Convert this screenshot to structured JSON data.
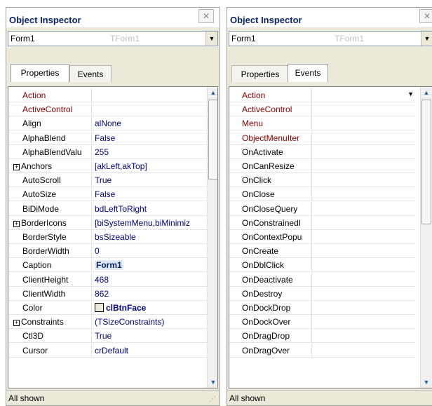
{
  "panels": [
    {
      "title": "Object Inspector",
      "combo": {
        "name": "Form1",
        "type": "TForm1"
      },
      "tabs": [
        "Properties",
        "Events"
      ],
      "active_tab": "Properties",
      "rows": [
        {
          "name": "Action",
          "value": "",
          "red": true
        },
        {
          "name": "ActiveControl",
          "value": "",
          "red": true
        },
        {
          "name": "Align",
          "value": "alNone"
        },
        {
          "name": "AlphaBlend",
          "value": "False"
        },
        {
          "name": "AlphaBlendValu",
          "value": "255"
        },
        {
          "name": "Anchors",
          "value": "[akLeft,akTop]",
          "expand": "⊞"
        },
        {
          "name": "AutoScroll",
          "value": "True"
        },
        {
          "name": "AutoSize",
          "value": "False"
        },
        {
          "name": "BiDiMode",
          "value": "bdLeftToRight"
        },
        {
          "name": "BorderIcons",
          "value": "[biSystemMenu,biMinimiz",
          "expand": "⊞"
        },
        {
          "name": "BorderStyle",
          "value": "bsSizeable"
        },
        {
          "name": "BorderWidth",
          "value": "0"
        },
        {
          "name": "Caption",
          "value": "Form1",
          "selected": true
        },
        {
          "name": "ClientHeight",
          "value": "468"
        },
        {
          "name": "ClientWidth",
          "value": "862"
        },
        {
          "name": "Color",
          "value": "clBtnFace",
          "swatch": true
        },
        {
          "name": "Constraints",
          "value": "(TSizeConstraints)",
          "expand": "⊞"
        },
        {
          "name": "Ctl3D",
          "value": "True"
        },
        {
          "name": "Cursor",
          "value": "crDefault"
        }
      ],
      "status": "All shown"
    },
    {
      "title": "Object Inspector",
      "combo": {
        "name": "Form1",
        "type": "TForm1"
      },
      "tabs": [
        "Properties",
        "Events"
      ],
      "active_tab": "Events",
      "rows": [
        {
          "name": "Action",
          "value": "",
          "red": true
        },
        {
          "name": "ActiveControl",
          "value": "",
          "red": true
        },
        {
          "name": "Menu",
          "value": "",
          "red": true
        },
        {
          "name": "ObjectMenuIter",
          "value": "",
          "red": true
        },
        {
          "name": "OnActivate",
          "value": ""
        },
        {
          "name": "OnCanResize",
          "value": ""
        },
        {
          "name": "OnClick",
          "value": ""
        },
        {
          "name": "OnClose",
          "value": ""
        },
        {
          "name": "OnCloseQuery",
          "value": ""
        },
        {
          "name": "OnConstrainedI",
          "value": ""
        },
        {
          "name": "OnContextPopu",
          "value": ""
        },
        {
          "name": "OnCreate",
          "value": ""
        },
        {
          "name": "OnDblClick",
          "value": ""
        },
        {
          "name": "OnDeactivate",
          "value": ""
        },
        {
          "name": "OnDestroy",
          "value": ""
        },
        {
          "name": "OnDockDrop",
          "value": ""
        },
        {
          "name": "OnDockOver",
          "value": ""
        },
        {
          "name": "OnDragDrop",
          "value": ""
        },
        {
          "name": "OnDragOver",
          "value": ""
        }
      ],
      "status": "All shown"
    }
  ],
  "icons": {
    "close": "close-icon",
    "dropdown": "dropdown-arrow-icon",
    "scroll_up": "scroll-up-icon",
    "scroll_down": "scroll-down-icon",
    "grip": "resize-grip-icon"
  },
  "colors": {
    "title": "#0a246a",
    "required_prop": "#8b0000",
    "value": "#000080",
    "panel_bg": "#ece9d8"
  }
}
